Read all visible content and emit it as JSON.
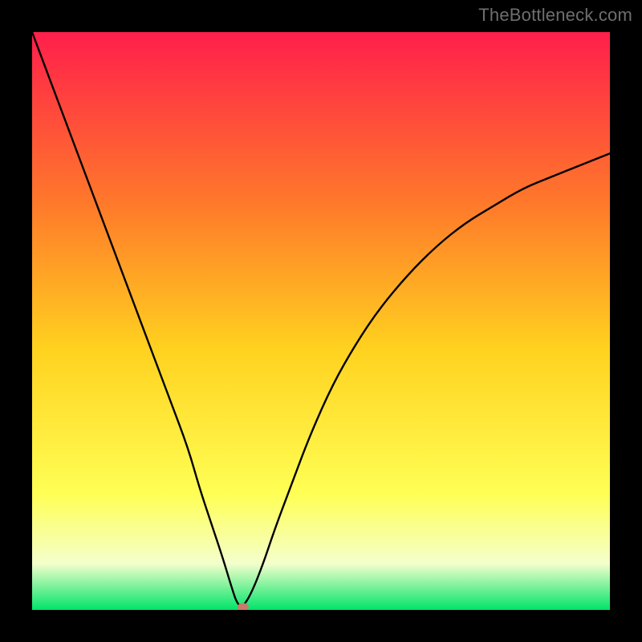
{
  "watermark": "TheBottleneck.com",
  "chart_data": {
    "type": "line",
    "title": "",
    "xlabel": "",
    "ylabel": "",
    "xlim": [
      0,
      100
    ],
    "ylim": [
      0,
      100
    ],
    "legend": false,
    "grid": false,
    "background_gradient": {
      "top_color": "#ff1f4b",
      "mid_color_1": "#ff7a2a",
      "mid_color_2": "#ffd21f",
      "mid_color_3": "#ffff55",
      "near_bottom_color": "#f4ffcc",
      "bottom_color": "#00e46a",
      "stops": [
        0,
        30,
        55,
        80,
        92,
        100
      ]
    },
    "series": [
      {
        "name": "bottleneck-curve",
        "color": "#000000",
        "x": [
          0,
          3,
          6,
          9,
          12,
          15,
          18,
          21,
          24,
          27,
          29,
          31,
          33,
          34.5,
          35.5,
          36.5,
          38,
          40,
          42,
          45,
          48,
          52,
          56,
          60,
          65,
          70,
          75,
          80,
          85,
          90,
          95,
          100
        ],
        "values": [
          100,
          92,
          84,
          76,
          68,
          60,
          52,
          44,
          36,
          28,
          21,
          15,
          9,
          4,
          1,
          0.5,
          3,
          8,
          14,
          22,
          30,
          39,
          46,
          52,
          58,
          63,
          67,
          70,
          73,
          75,
          77,
          79
        ]
      }
    ],
    "marker": {
      "name": "optimal-point",
      "x": 36.5,
      "y": 0.5,
      "color": "#c97a6a",
      "rx": 7,
      "ry": 5
    }
  }
}
